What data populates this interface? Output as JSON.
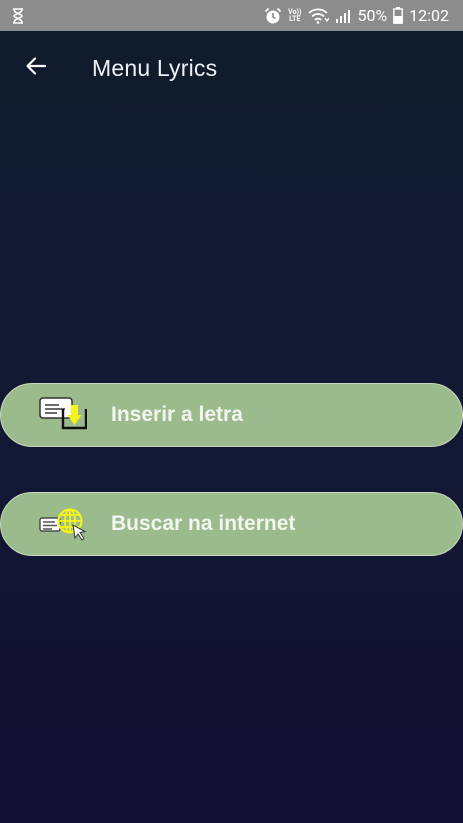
{
  "status_bar": {
    "left_icon": "hourglass-icon",
    "volte_top": "Vo))",
    "volte_bottom": "LTE",
    "battery": "50%",
    "time": "12:02",
    "icons": [
      "alarm-icon",
      "volte-icon",
      "wifi-icon",
      "signal-icon",
      "battery-icon"
    ]
  },
  "app_bar": {
    "back_icon": "arrow-left-icon",
    "title": "Menu Lyrics"
  },
  "menu": {
    "items": [
      {
        "label": "Inserir a letra",
        "icon": "insert-lyrics-icon"
      },
      {
        "label": "Buscar na internet",
        "icon": "search-internet-icon"
      }
    ]
  },
  "colors": {
    "background_top": "#0f1b2a",
    "background_bottom": "#120f33",
    "status_bar": "#8c8c8c",
    "button_fill": "#9bbb8c",
    "icon_accent": "#f5f51a"
  }
}
